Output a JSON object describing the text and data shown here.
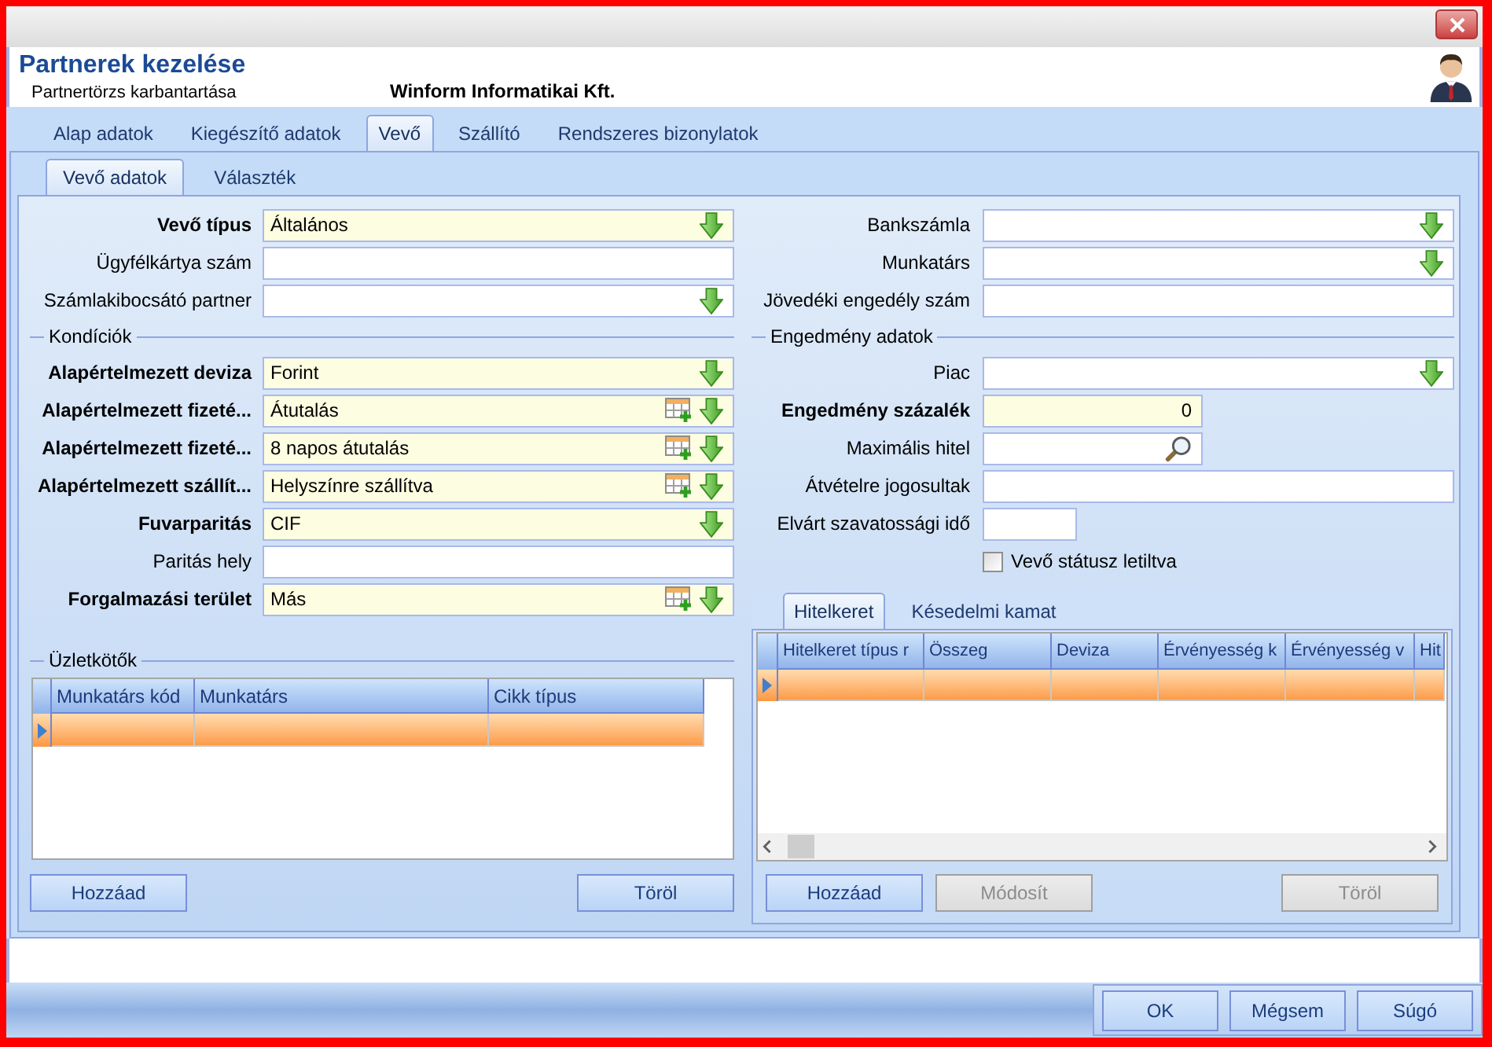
{
  "window": {
    "title": "Partnerek kezelése",
    "subtitle": "Partnertörzs karbantartása",
    "company": "Winform Informatikai Kft."
  },
  "tabs": [
    {
      "label": "Alap adatok",
      "selected": false
    },
    {
      "label": "Kiegészítő adatok",
      "selected": false
    },
    {
      "label": "Vevő",
      "selected": true
    },
    {
      "label": "Szállító",
      "selected": false
    },
    {
      "label": "Rendszeres bizonylatok",
      "selected": false
    }
  ],
  "subtabs": [
    {
      "label": "Vevő adatok",
      "selected": true
    },
    {
      "label": "Választék",
      "selected": false
    }
  ],
  "left_fields": [
    {
      "label": "Vevő típus",
      "kind": "dropdown",
      "required": true,
      "value": "Általános"
    },
    {
      "label": "Ügyfélkártya szám",
      "kind": "text",
      "required": false
    },
    {
      "label": "Számlakibocsátó partner",
      "kind": "dropdown",
      "required": false
    }
  ],
  "conditions": {
    "title": "Kondíciók",
    "fields": [
      {
        "label": "Alapértelmezett deviza",
        "kind": "dropdown",
        "required": true,
        "value": "Forint"
      },
      {
        "label": "Alapértelmezett fizeté...",
        "kind": "lookup",
        "required": true,
        "value": "Átutalás"
      },
      {
        "label": "Alapértelmezett fizeté...",
        "kind": "lookup",
        "required": true,
        "value": "8 napos átutalás"
      },
      {
        "label": "Alapértelmezett szállít...",
        "kind": "lookup",
        "required": true,
        "value": "Helyszínre szállítva"
      },
      {
        "label": "Fuvarparitás",
        "kind": "dropdown",
        "required": true,
        "value": "CIF"
      },
      {
        "label": "Paritás hely",
        "kind": "text",
        "required": false
      },
      {
        "label": "Forgalmazási terület",
        "kind": "lookup",
        "required": true,
        "value": "Más"
      }
    ]
  },
  "dealers": {
    "title": "Üzletkötők",
    "columns": [
      "Munkatárs kód",
      "Munkatárs",
      "Cikk típus"
    ],
    "rows": [
      {
        "selected": true
      }
    ],
    "buttons": [
      {
        "label": "Hozzáad",
        "disabled": false
      },
      {
        "label": "Töröl",
        "disabled": false
      }
    ]
  },
  "right_fields": [
    {
      "label": "Bankszámla",
      "kind": "dropdown",
      "required": false
    },
    {
      "label": "Munkatárs",
      "kind": "dropdown",
      "required": false
    },
    {
      "label": "Jövedéki engedély szám",
      "kind": "text",
      "required": false
    }
  ],
  "discount": {
    "title": "Engedmény adatok",
    "fields": [
      {
        "label": "Piac",
        "kind": "dropdown",
        "required": false
      },
      {
        "label": "Engedmény százalék",
        "kind": "number",
        "required": true,
        "value": "0"
      },
      {
        "label": "Maximális hitel",
        "kind": "search",
        "required": false
      },
      {
        "label": "Átvételre jogosultak",
        "kind": "text",
        "required": false
      },
      {
        "label": "Elvárt szavatossági idő",
        "kind": "short",
        "required": false
      }
    ],
    "checkbox": {
      "label": "Vevő státusz letiltva",
      "checked": false
    }
  },
  "credit": {
    "tabs": [
      {
        "label": "Hitelkeret",
        "selected": true
      },
      {
        "label": "Késedelmi kamat",
        "selected": false
      }
    ],
    "columns": [
      "Hitelkeret típus r",
      "Összeg",
      "Deviza",
      "Érvényesség k",
      "Érvényesség v",
      "Hit"
    ],
    "rows": [
      {
        "selected": true
      }
    ],
    "buttons": [
      {
        "label": "Hozzáad",
        "disabled": false
      },
      {
        "label": "Módosít",
        "disabled": true
      },
      {
        "label": "Töröl",
        "disabled": true
      }
    ]
  },
  "footer_buttons": [
    "OK",
    "Mégsem",
    "Súgó"
  ]
}
